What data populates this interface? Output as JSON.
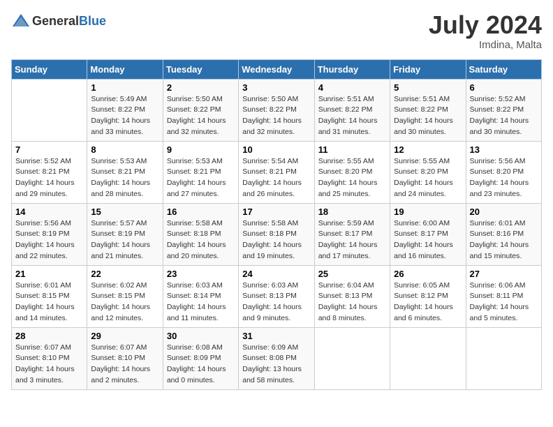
{
  "header": {
    "logo_general": "General",
    "logo_blue": "Blue",
    "title": "July 2024",
    "location": "Imdina, Malta"
  },
  "days_of_week": [
    "Sunday",
    "Monday",
    "Tuesday",
    "Wednesday",
    "Thursday",
    "Friday",
    "Saturday"
  ],
  "weeks": [
    [
      {
        "day": "",
        "info": ""
      },
      {
        "day": "1",
        "info": "Sunrise: 5:49 AM\nSunset: 8:22 PM\nDaylight: 14 hours\nand 33 minutes."
      },
      {
        "day": "2",
        "info": "Sunrise: 5:50 AM\nSunset: 8:22 PM\nDaylight: 14 hours\nand 32 minutes."
      },
      {
        "day": "3",
        "info": "Sunrise: 5:50 AM\nSunset: 8:22 PM\nDaylight: 14 hours\nand 32 minutes."
      },
      {
        "day": "4",
        "info": "Sunrise: 5:51 AM\nSunset: 8:22 PM\nDaylight: 14 hours\nand 31 minutes."
      },
      {
        "day": "5",
        "info": "Sunrise: 5:51 AM\nSunset: 8:22 PM\nDaylight: 14 hours\nand 30 minutes."
      },
      {
        "day": "6",
        "info": "Sunrise: 5:52 AM\nSunset: 8:22 PM\nDaylight: 14 hours\nand 30 minutes."
      }
    ],
    [
      {
        "day": "7",
        "info": "Sunrise: 5:52 AM\nSunset: 8:21 PM\nDaylight: 14 hours\nand 29 minutes."
      },
      {
        "day": "8",
        "info": "Sunrise: 5:53 AM\nSunset: 8:21 PM\nDaylight: 14 hours\nand 28 minutes."
      },
      {
        "day": "9",
        "info": "Sunrise: 5:53 AM\nSunset: 8:21 PM\nDaylight: 14 hours\nand 27 minutes."
      },
      {
        "day": "10",
        "info": "Sunrise: 5:54 AM\nSunset: 8:21 PM\nDaylight: 14 hours\nand 26 minutes."
      },
      {
        "day": "11",
        "info": "Sunrise: 5:55 AM\nSunset: 8:20 PM\nDaylight: 14 hours\nand 25 minutes."
      },
      {
        "day": "12",
        "info": "Sunrise: 5:55 AM\nSunset: 8:20 PM\nDaylight: 14 hours\nand 24 minutes."
      },
      {
        "day": "13",
        "info": "Sunrise: 5:56 AM\nSunset: 8:20 PM\nDaylight: 14 hours\nand 23 minutes."
      }
    ],
    [
      {
        "day": "14",
        "info": "Sunrise: 5:56 AM\nSunset: 8:19 PM\nDaylight: 14 hours\nand 22 minutes."
      },
      {
        "day": "15",
        "info": "Sunrise: 5:57 AM\nSunset: 8:19 PM\nDaylight: 14 hours\nand 21 minutes."
      },
      {
        "day": "16",
        "info": "Sunrise: 5:58 AM\nSunset: 8:18 PM\nDaylight: 14 hours\nand 20 minutes."
      },
      {
        "day": "17",
        "info": "Sunrise: 5:58 AM\nSunset: 8:18 PM\nDaylight: 14 hours\nand 19 minutes."
      },
      {
        "day": "18",
        "info": "Sunrise: 5:59 AM\nSunset: 8:17 PM\nDaylight: 14 hours\nand 17 minutes."
      },
      {
        "day": "19",
        "info": "Sunrise: 6:00 AM\nSunset: 8:17 PM\nDaylight: 14 hours\nand 16 minutes."
      },
      {
        "day": "20",
        "info": "Sunrise: 6:01 AM\nSunset: 8:16 PM\nDaylight: 14 hours\nand 15 minutes."
      }
    ],
    [
      {
        "day": "21",
        "info": "Sunrise: 6:01 AM\nSunset: 8:15 PM\nDaylight: 14 hours\nand 14 minutes."
      },
      {
        "day": "22",
        "info": "Sunrise: 6:02 AM\nSunset: 8:15 PM\nDaylight: 14 hours\nand 12 minutes."
      },
      {
        "day": "23",
        "info": "Sunrise: 6:03 AM\nSunset: 8:14 PM\nDaylight: 14 hours\nand 11 minutes."
      },
      {
        "day": "24",
        "info": "Sunrise: 6:03 AM\nSunset: 8:13 PM\nDaylight: 14 hours\nand 9 minutes."
      },
      {
        "day": "25",
        "info": "Sunrise: 6:04 AM\nSunset: 8:13 PM\nDaylight: 14 hours\nand 8 minutes."
      },
      {
        "day": "26",
        "info": "Sunrise: 6:05 AM\nSunset: 8:12 PM\nDaylight: 14 hours\nand 6 minutes."
      },
      {
        "day": "27",
        "info": "Sunrise: 6:06 AM\nSunset: 8:11 PM\nDaylight: 14 hours\nand 5 minutes."
      }
    ],
    [
      {
        "day": "28",
        "info": "Sunrise: 6:07 AM\nSunset: 8:10 PM\nDaylight: 14 hours\nand 3 minutes."
      },
      {
        "day": "29",
        "info": "Sunrise: 6:07 AM\nSunset: 8:10 PM\nDaylight: 14 hours\nand 2 minutes."
      },
      {
        "day": "30",
        "info": "Sunrise: 6:08 AM\nSunset: 8:09 PM\nDaylight: 14 hours\nand 0 minutes."
      },
      {
        "day": "31",
        "info": "Sunrise: 6:09 AM\nSunset: 8:08 PM\nDaylight: 13 hours\nand 58 minutes."
      },
      {
        "day": "",
        "info": ""
      },
      {
        "day": "",
        "info": ""
      },
      {
        "day": "",
        "info": ""
      }
    ]
  ]
}
